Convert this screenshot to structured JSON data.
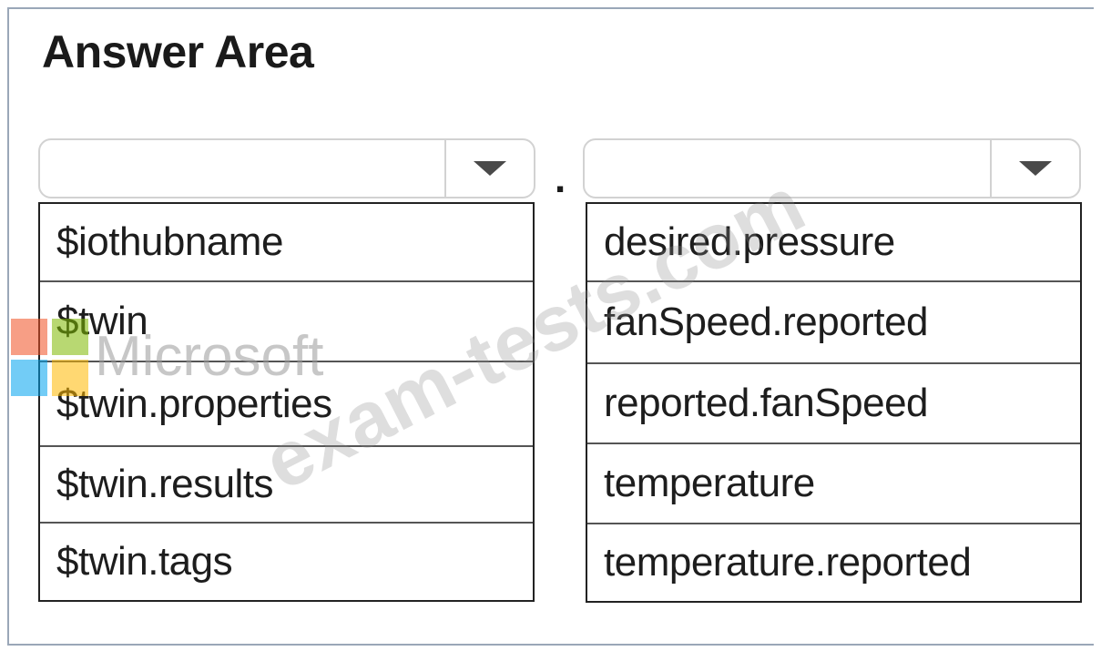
{
  "title": "Answer Area",
  "separator": ".",
  "left_dropdown": {
    "selected": "",
    "options": [
      "$iothubname",
      "$twin",
      "$twin.properties",
      "$twin.results",
      "$twin.tags"
    ]
  },
  "right_dropdown": {
    "selected": "",
    "options": [
      "desired.pressure",
      "fanSpeed.reported",
      "reported.fanSpeed",
      "temperature",
      "temperature.reported"
    ]
  },
  "watermark": {
    "brand": "Microsoft",
    "site": "exam-tests.com",
    "logo_colors": [
      "#f25022",
      "#7fba00",
      "#00a4ef",
      "#ffb900"
    ]
  }
}
